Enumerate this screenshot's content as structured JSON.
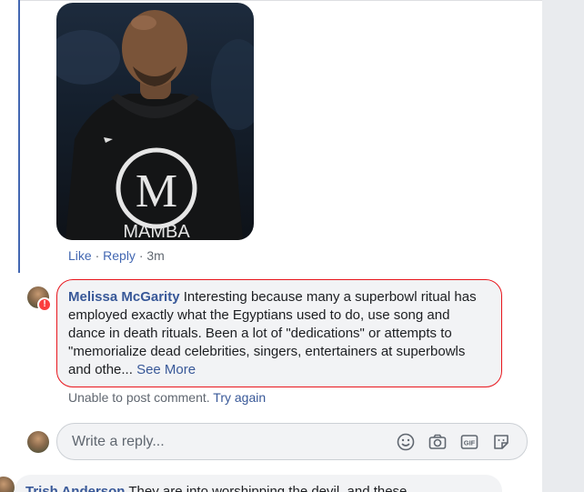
{
  "comment_photo": {
    "icon": "photo-of-man-in-mamba-hoodie",
    "hoodie_text": "MAMBA",
    "logo_letter": "M"
  },
  "comment_actions": {
    "like": "Like",
    "reply": "Reply",
    "time": "3m"
  },
  "reply": {
    "author": "Melissa McGarity",
    "text": "Interesting because many a superbowl ritual has employed exactly what the Egyptians used to do, use song and dance in death rituals. Been a lot of \"dedications\" or attempts to \"memorialize dead celebrities, singers, entertainers at superbowls and othe...",
    "see_more": "See More",
    "error_badge": "!",
    "error_color": "#fa3e3e"
  },
  "post_status": {
    "message": "Unable to post comment.",
    "retry": "Try again"
  },
  "composer": {
    "placeholder": "Write a reply...",
    "icons": [
      "emoji-icon",
      "camera-icon",
      "gif-icon",
      "sticker-icon"
    ],
    "gif_label": "GIF"
  },
  "next_comment": {
    "author": "Trish Anderson",
    "text": "They are into worshipping the devil, and these"
  },
  "colors": {
    "link": "#385898",
    "thread_line": "#4267b2",
    "error_border": "#e8151c"
  }
}
